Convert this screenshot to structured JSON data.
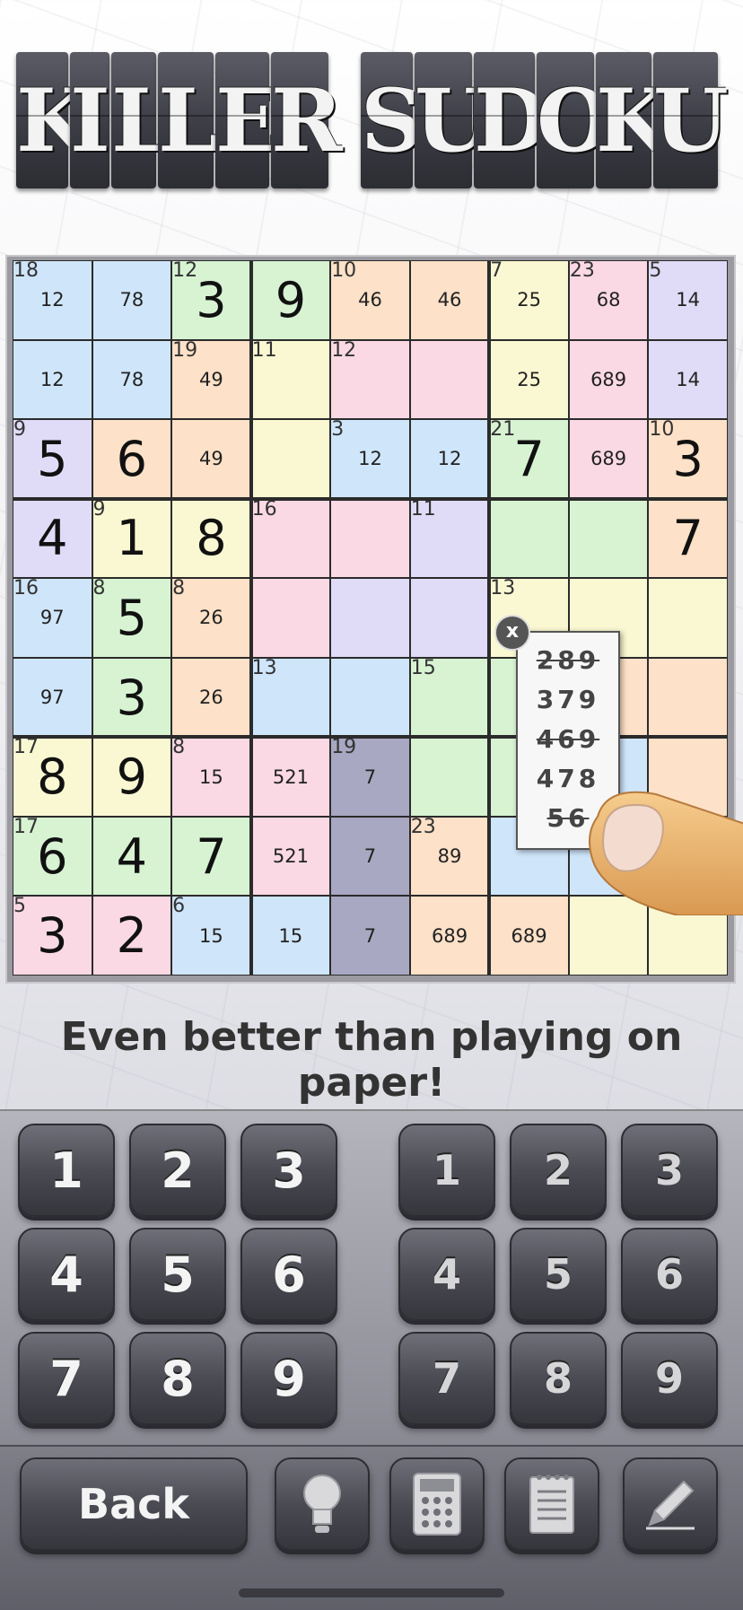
{
  "title": {
    "word1": [
      "K",
      "I",
      "L",
      "L",
      "E",
      "R"
    ],
    "word2": [
      "S",
      "U",
      "D",
      "O",
      "K",
      "U"
    ]
  },
  "grid": {
    "rows": [
      [
        {
          "cage": "18",
          "small": "12",
          "bg": "#cfe5fa"
        },
        {
          "small": "78",
          "bg": "#cfe5fa"
        },
        {
          "cage": "12",
          "big": "3",
          "bg": "#d7f3d2"
        },
        {
          "big": "9",
          "bg": "#d7f3d2"
        },
        {
          "cage": "10",
          "small": "46",
          "bg": "#fde1c8"
        },
        {
          "small": "46",
          "bg": "#fde1c8"
        },
        {
          "cage": "7",
          "small": "25",
          "bg": "#f9f8d2"
        },
        {
          "cage": "23",
          "small": "68",
          "bg": "#fbd9e4"
        },
        {
          "cage": "5",
          "small": "14",
          "bg": "#e0dbf6"
        }
      ],
      [
        {
          "small": "12",
          "bg": "#cfe5fa"
        },
        {
          "small": "78",
          "bg": "#cfe5fa"
        },
        {
          "cage": "19",
          "small": "49",
          "bg": "#fde1c8"
        },
        {
          "cage": "11",
          "bg": "#f9f8d2"
        },
        {
          "cage": "12",
          "bg": "#fbd9e4"
        },
        {
          "bg": "#fbd9e4"
        },
        {
          "small": "25",
          "bg": "#f9f8d2"
        },
        {
          "small": "689",
          "bg": "#fbd9e4"
        },
        {
          "small": "14",
          "bg": "#e0dbf6"
        }
      ],
      [
        {
          "cage": "9",
          "big": "5",
          "bg": "#e0dbf6"
        },
        {
          "big": "6",
          "bg": "#fde1c8"
        },
        {
          "small": "49",
          "bg": "#fde1c8"
        },
        {
          "bg": "#f9f8d2"
        },
        {
          "cage": "3",
          "small": "12",
          "bg": "#cfe5fa"
        },
        {
          "small": "12",
          "bg": "#cfe5fa"
        },
        {
          "cage": "21",
          "big": "7",
          "bg": "#d7f3d2"
        },
        {
          "small": "689",
          "bg": "#fbd9e4"
        },
        {
          "cage": "10",
          "big": "3",
          "bg": "#fde1c8"
        }
      ],
      [
        {
          "big": "4",
          "bg": "#e0dbf6"
        },
        {
          "cage": "9",
          "big": "1",
          "bg": "#f9f8d2"
        },
        {
          "big": "8",
          "bg": "#f9f8d2"
        },
        {
          "cage": "16",
          "bg": "#fbd9e4"
        },
        {
          "bg": "#fbd9e4"
        },
        {
          "cage": "11",
          "bg": "#e0dbf6"
        },
        {
          "bg": "#d7f3d2"
        },
        {
          "bg": "#d7f3d2"
        },
        {
          "big": "7",
          "bg": "#fde1c8"
        }
      ],
      [
        {
          "cage": "16",
          "small": "97",
          "bg": "#cfe5fa"
        },
        {
          "cage": "8",
          "big": "5",
          "bg": "#d7f3d2"
        },
        {
          "cage": "8",
          "small": "26",
          "bg": "#fde1c8"
        },
        {
          "bg": "#fbd9e4"
        },
        {
          "bg": "#e0dbf6"
        },
        {
          "bg": "#e0dbf6"
        },
        {
          "cage": "13",
          "bg": "#f9f8d2"
        },
        {
          "bg": "#f9f8d2"
        },
        {
          "bg": "#f9f8d2"
        }
      ],
      [
        {
          "small": "97",
          "bg": "#cfe5fa"
        },
        {
          "big": "3",
          "bg": "#d7f3d2"
        },
        {
          "small": "26",
          "bg": "#fde1c8"
        },
        {
          "cage": "13",
          "bg": "#cfe5fa"
        },
        {
          "bg": "#cfe5fa"
        },
        {
          "cage": "15",
          "bg": "#d7f3d2"
        },
        {
          "bg": "#d7f3d2"
        },
        {
          "bg": "#fde1c8"
        },
        {
          "bg": "#fde1c8"
        }
      ],
      [
        {
          "cage": "17",
          "big": "8",
          "bg": "#f9f8d2"
        },
        {
          "big": "9",
          "bg": "#f9f8d2"
        },
        {
          "cage": "8",
          "small": "15",
          "bg": "#fbd9e4"
        },
        {
          "small": "521",
          "bg": "#fbd9e4"
        },
        {
          "cage": "19",
          "small": "7",
          "bg": "#a9a8c2"
        },
        {
          "bg": "#d7f3d2"
        },
        {
          "bg": "#d7f3d2"
        },
        {
          "bg": "#cfe5fa"
        },
        {
          "bg": "#fde1c8"
        }
      ],
      [
        {
          "cage": "17",
          "big": "6",
          "bg": "#d7f3d2"
        },
        {
          "big": "4",
          "bg": "#d7f3d2"
        },
        {
          "big": "7",
          "bg": "#d7f3d2"
        },
        {
          "small": "521",
          "bg": "#fbd9e4"
        },
        {
          "small": "7",
          "bg": "#a9a8c2"
        },
        {
          "cage": "23",
          "small": "89",
          "bg": "#fde1c8"
        },
        {
          "bg": "#cfe5fa"
        },
        {
          "bg": "#cfe5fa"
        },
        {
          "bg": "#fde1c8"
        }
      ],
      [
        {
          "cage": "5",
          "big": "3",
          "bg": "#fbd9e4"
        },
        {
          "big": "2",
          "bg": "#fbd9e4"
        },
        {
          "cage": "6",
          "small": "15",
          "bg": "#cfe5fa"
        },
        {
          "small": "15",
          "bg": "#cfe5fa"
        },
        {
          "small": "7",
          "bg": "#a9a8c2"
        },
        {
          "small": "689",
          "bg": "#fde1c8"
        },
        {
          "small": "689",
          "bg": "#fde1c8"
        },
        {
          "bg": "#f9f8d2"
        },
        {
          "bg": "#f9f8d2"
        }
      ]
    ]
  },
  "popup": {
    "close_label": "x",
    "combos": [
      {
        "text": "289",
        "struck": true
      },
      {
        "text": "379",
        "struck": false
      },
      {
        "text": "469",
        "struck": true
      },
      {
        "text": "478",
        "struck": false
      },
      {
        "text": "56",
        "struck": true
      }
    ]
  },
  "tagline": "Even better than playing on paper!",
  "keypad": {
    "digits_left": [
      "1",
      "2",
      "3",
      "4",
      "5",
      "6",
      "7",
      "8",
      "9"
    ],
    "digits_right": [
      "1",
      "2",
      "3",
      "4",
      "5",
      "6",
      "7",
      "8",
      "9"
    ]
  },
  "toolbar": {
    "back_label": "Back",
    "icons": [
      "lightbulb-icon",
      "calculator-icon",
      "notepad-icon",
      "pencil-icon"
    ]
  }
}
